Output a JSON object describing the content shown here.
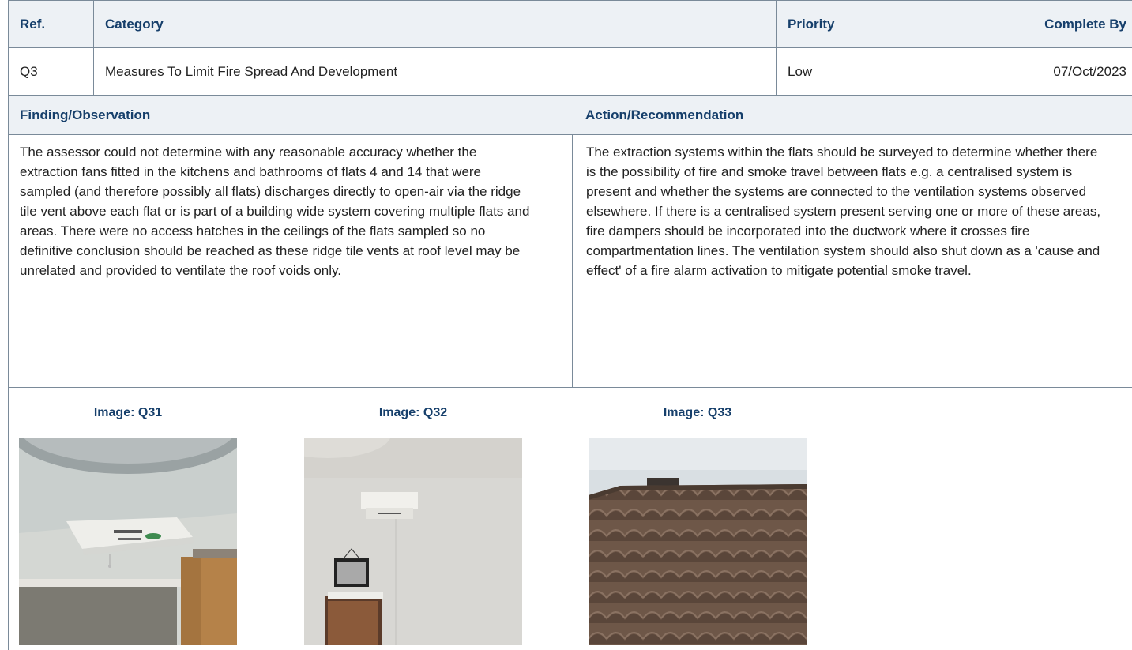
{
  "header": {
    "ref": "Ref.",
    "category": "Category",
    "priority": "Priority",
    "complete_by": "Complete By"
  },
  "item": {
    "ref": "Q3",
    "category": "Measures To Limit Fire Spread And Development",
    "priority": "Low",
    "complete_by": "07/Oct/2023"
  },
  "finding": {
    "heading": "Finding/Observation",
    "text": "The assessor could not determine with any reasonable accuracy whether the extraction fans fitted in the kitchens and bathrooms of flats 4 and 14 that were sampled (and therefore possibly all flats) discharges directly to open-air via the ridge tile vent above each flat or is part of a building wide system covering multiple flats and areas. There were no access hatches in the ceilings of the flats sampled so no definitive conclusion should be reached as these ridge tile vents at roof level may be unrelated and provided to ventilate the roof voids only."
  },
  "action": {
    "heading": "Action/Recommendation",
    "text": "The extraction systems within the flats should be surveyed to determine whether there is the possibility of fire and smoke travel between flats e.g. a centralised system is present and whether the systems are connected to the ventilation systems observed elsewhere. If there is a centralised system present serving one or more of these areas, fire dampers should be incorporated into the ductwork where it crosses fire compartmentation lines. The ventilation system should also shut down as a 'cause and effect' of a fire alarm activation to mitigate potential smoke travel."
  },
  "images": [
    {
      "caption": "Image: Q31"
    },
    {
      "caption": "Image: Q32"
    },
    {
      "caption": "Image: Q33"
    }
  ]
}
